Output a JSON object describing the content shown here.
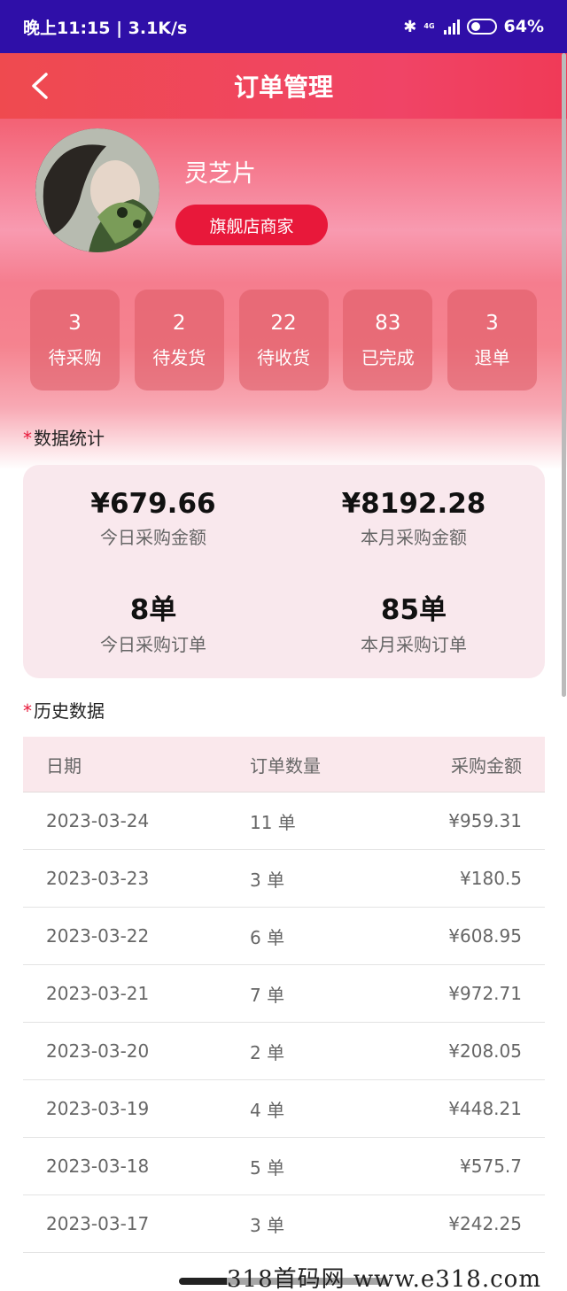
{
  "status_bar": {
    "time_speed": "晚上11:15 | 3.1K/s",
    "network": "4G",
    "battery": "64%"
  },
  "nav": {
    "title": "订单管理"
  },
  "profile": {
    "name": "灵芝片",
    "badge": "旗舰店商家"
  },
  "order_stats": [
    {
      "count": "3",
      "label": "待采购"
    },
    {
      "count": "2",
      "label": "待发货"
    },
    {
      "count": "22",
      "label": "待收货"
    },
    {
      "count": "83",
      "label": "已完成"
    },
    {
      "count": "3",
      "label": "退单"
    }
  ],
  "statistics": {
    "title": "数据统计",
    "items": [
      {
        "value": "¥679.66",
        "label": "今日采购金额"
      },
      {
        "value": "¥8192.28",
        "label": "本月采购金额"
      },
      {
        "value": "8单",
        "label": "今日采购订单"
      },
      {
        "value": "85单",
        "label": "本月采购订单"
      }
    ]
  },
  "history": {
    "title": "历史数据",
    "headers": {
      "date": "日期",
      "count": "订单数量",
      "amount": "采购金额"
    },
    "rows": [
      {
        "date": "2023-03-24",
        "count": "11 单",
        "amount": "¥959.31"
      },
      {
        "date": "2023-03-23",
        "count": "3 单",
        "amount": "¥180.5"
      },
      {
        "date": "2023-03-22",
        "count": "6 单",
        "amount": "¥608.95"
      },
      {
        "date": "2023-03-21",
        "count": "7 单",
        "amount": "¥972.71"
      },
      {
        "date": "2023-03-20",
        "count": "2 单",
        "amount": "¥208.05"
      },
      {
        "date": "2023-03-19",
        "count": "4 单",
        "amount": "¥448.21"
      },
      {
        "date": "2023-03-18",
        "count": "5 单",
        "amount": "¥575.7"
      },
      {
        "date": "2023-03-17",
        "count": "3 单",
        "amount": "¥242.25"
      }
    ]
  },
  "watermark": "318首码网 www.e318.com",
  "colors": {
    "accent": "#e8183a",
    "status_bar": "#2f0fa8"
  }
}
